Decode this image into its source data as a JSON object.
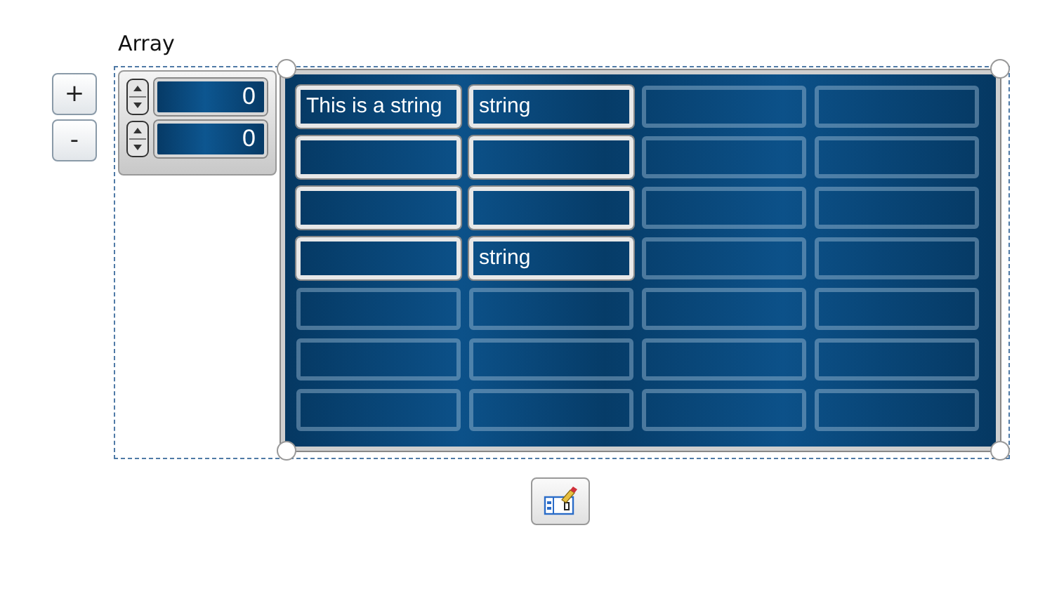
{
  "label": "Array",
  "size_buttons": [
    "+",
    "-"
  ],
  "indices": [
    {
      "value": "0"
    },
    {
      "value": "0"
    }
  ],
  "rows": [
    {
      "cells": [
        {
          "active": true,
          "text": "This is a string"
        },
        {
          "active": true,
          "text": "string"
        },
        {
          "active": false
        },
        {
          "active": false
        }
      ]
    },
    {
      "cells": [
        {
          "active": true
        },
        {
          "active": true
        },
        {
          "active": false
        },
        {
          "active": false
        }
      ]
    },
    {
      "cells": [
        {
          "active": true
        },
        {
          "active": true
        },
        {
          "active": false
        },
        {
          "active": false
        }
      ]
    },
    {
      "cells": [
        {
          "active": true
        },
        {
          "active": true,
          "text": "string"
        },
        {
          "active": false
        },
        {
          "active": false
        }
      ]
    },
    {
      "cells": [
        {
          "active": false
        },
        {
          "active": false
        },
        {
          "active": false
        },
        {
          "active": false
        }
      ]
    },
    {
      "cells": [
        {
          "active": false
        },
        {
          "active": false
        },
        {
          "active": false
        },
        {
          "active": false
        }
      ]
    },
    {
      "cells": [
        {
          "active": false
        },
        {
          "active": false
        },
        {
          "active": false
        },
        {
          "active": false
        }
      ]
    }
  ]
}
